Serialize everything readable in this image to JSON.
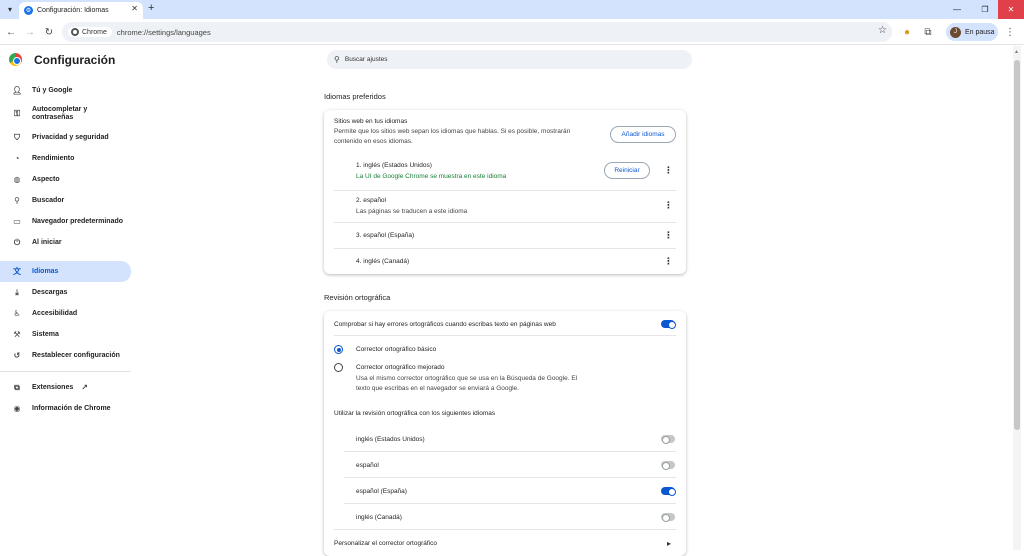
{
  "tab": {
    "title": "Configuración: Idiomas"
  },
  "omnibox": {
    "chip": "Chrome",
    "url": "chrome://settings/languages"
  },
  "profile": {
    "initial": "J",
    "label": "En pausa"
  },
  "app": {
    "title": "Configuración"
  },
  "search": {
    "placeholder": "Buscar ajustes"
  },
  "sidebar": {
    "items": [
      {
        "label": "Tú y Google"
      },
      {
        "label": "Autocompletar y contraseñas"
      },
      {
        "label": "Privacidad y seguridad"
      },
      {
        "label": "Rendimiento"
      },
      {
        "label": "Aspecto"
      },
      {
        "label": "Buscador"
      },
      {
        "label": "Navegador predeterminado"
      },
      {
        "label": "Al iniciar"
      },
      {
        "label": "Idiomas"
      },
      {
        "label": "Descargas"
      },
      {
        "label": "Accesibilidad"
      },
      {
        "label": "Sistema"
      },
      {
        "label": "Restablecer configuración"
      },
      {
        "label": "Extensiones"
      },
      {
        "label": "Información de Chrome"
      }
    ]
  },
  "preferred": {
    "section_title": "Idiomas preferidos",
    "heading": "Sitios web en tus idiomas",
    "description_line1": "Permite que los sitios web sepan los idiomas que hablas. Si es posible, mostrarán",
    "description_line2": "contenido en esos idiomas.",
    "add_button": "Añadir idiomas",
    "languages": [
      {
        "name": "1. inglés (Estados Unidos)",
        "note": "La UI de Google Chrome se muestra en este idioma",
        "action": "Reiniciar"
      },
      {
        "name": "2. español",
        "note": "Las páginas se traducen a este idioma"
      },
      {
        "name": "3. español (España)"
      },
      {
        "name": "4. inglés (Canadá)"
      }
    ]
  },
  "spell": {
    "section_title": "Revisión ortográfica",
    "check_label": "Comprobar si hay errores ortográficos cuando escribas texto en páginas web",
    "basic_label": "Corrector ortográfico básico",
    "enhanced_label": "Corrector ortográfico mejorado",
    "enhanced_desc1": "Usa el mismo corrector ortográfico que se usa en la Búsqueda de Google. El",
    "enhanced_desc2": "texto que escribas en el navegador se enviará a Google.",
    "languages_heading": "Utilizar la revisión ortográfica con los siguientes idiomas",
    "languages": [
      {
        "name": "inglés (Estados Unidos)",
        "enabled": false
      },
      {
        "name": "español",
        "enabled": false
      },
      {
        "name": "español (España)",
        "enabled": true
      },
      {
        "name": "inglés (Canadá)",
        "enabled": false
      }
    ],
    "customize_label": "Personalizar el corrector ortográfico"
  }
}
